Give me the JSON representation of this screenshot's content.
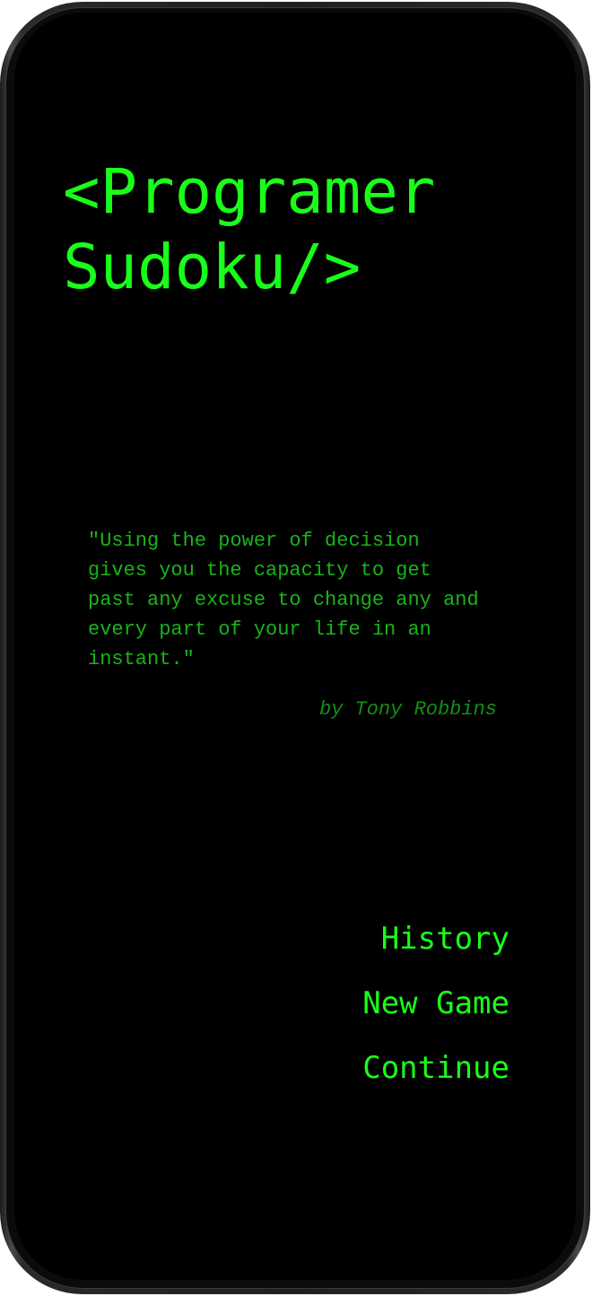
{
  "app": {
    "title_line1": "<Programer",
    "title_line2": "Sudoku/>"
  },
  "quote": {
    "lines": [
      "\"Using the power of decision",
      "gives you the capacity to get",
      "past any excuse to change any and",
      "every part of your life in an",
      "instant.\""
    ],
    "author": "by Tony Robbins"
  },
  "menu": {
    "history_label": "History",
    "new_game_label": "New Game",
    "continue_label": "Continue"
  },
  "colors": {
    "accent": "#1aff1a",
    "quote_text": "#1ab31a",
    "author_text": "#138f13",
    "background": "#000000"
  }
}
